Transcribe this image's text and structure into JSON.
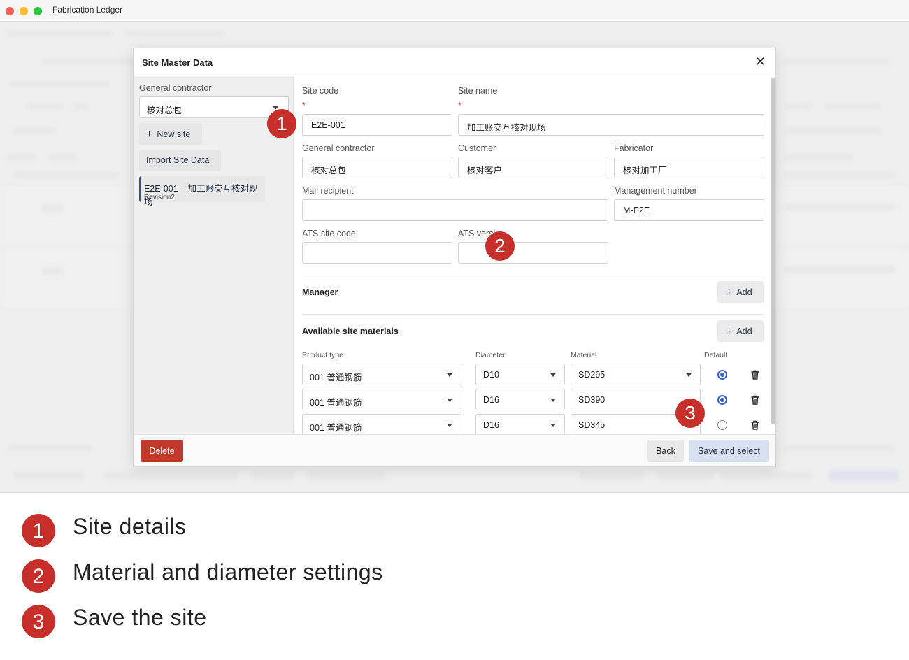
{
  "window": {
    "title": "Fabrication Ledger"
  },
  "dialog": {
    "title": "Site Master Data",
    "close_icon": "close-icon"
  },
  "sidebar": {
    "general_contractor_label": "General contractor",
    "general_contractor_value": "核对总包",
    "new_site_label": "New site",
    "import_label": "Import Site Data",
    "site_item": {
      "code": "E2E-001",
      "name": "加工账交互核对现场",
      "revision": "Revision2"
    }
  },
  "form": {
    "site_code": {
      "label": "Site code",
      "required_mark": "*",
      "value": "E2E-001"
    },
    "site_name": {
      "label": "Site name",
      "required_mark": "*",
      "value": "加工账交互核对现场"
    },
    "general_contractor": {
      "label": "General contractor",
      "value": "核对总包"
    },
    "customer": {
      "label": "Customer",
      "value": "核对客户"
    },
    "fabricator": {
      "label": "Fabricator",
      "value": "核对加工厂"
    },
    "mail_recipient": {
      "label": "Mail recipient",
      "value": ""
    },
    "management_number": {
      "label": "Management number",
      "value": "M-E2E"
    },
    "ats_site_code": {
      "label": "ATS site code",
      "value": ""
    },
    "ats_version": {
      "label": "ATS versi",
      "value": ""
    }
  },
  "manager": {
    "title": "Manager",
    "add_label": "Add"
  },
  "materials": {
    "title": "Available site materials",
    "add_label": "Add",
    "columns": [
      "Product type",
      "Diameter",
      "Material",
      "Default"
    ],
    "rows": [
      {
        "product_type": "001 普通钢筋",
        "diameter": "D10",
        "material": "SD295",
        "default": true
      },
      {
        "product_type": "001 普通钢筋",
        "diameter": "D16",
        "material": "SD390",
        "default": true
      },
      {
        "product_type": "001 普通钢筋",
        "diameter": "D16",
        "material": "SD345",
        "default": false
      }
    ]
  },
  "footer": {
    "delete_label": "Delete",
    "back_label": "Back",
    "save_label": "Save and select"
  },
  "callouts": [
    {
      "number": "1",
      "text": "Site details"
    },
    {
      "number": "2",
      "text": "Material and diameter settings"
    },
    {
      "number": "3",
      "text": "Save the site"
    }
  ],
  "colors": {
    "accent": "#3a62c5",
    "danger": "#c0392b",
    "badge": "#c62f2a"
  }
}
